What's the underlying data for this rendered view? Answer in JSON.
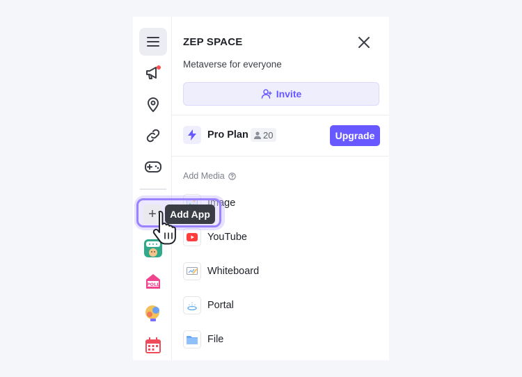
{
  "header": {
    "title": "ZEP SPACE",
    "subtitle": "Metaverse for everyone"
  },
  "invite": {
    "label": "Invite"
  },
  "plan": {
    "name": "Pro Plan",
    "member_count": "20",
    "upgrade_label": "Upgrade"
  },
  "media": {
    "section_label": "Add Media",
    "items": [
      {
        "label": "Image",
        "icon": "image-icon"
      },
      {
        "label": "YouTube",
        "icon": "youtube-icon"
      },
      {
        "label": "Whiteboard",
        "icon": "whiteboard-icon"
      },
      {
        "label": "Portal",
        "icon": "portal-icon"
      },
      {
        "label": "File",
        "icon": "folder-icon"
      }
    ]
  },
  "sidebar": {
    "items": [
      "menu-icon",
      "announcement-icon",
      "location-pin-icon",
      "link-icon",
      "gamepad-icon"
    ],
    "apps": [
      "chat-app-icon",
      "poll-app-icon",
      "quiz-app-icon",
      "calendar-app-icon"
    ]
  },
  "tooltip": {
    "label": "Add App",
    "button_glyph": "+"
  },
  "colors": {
    "accent": "#6758ff",
    "accent_light": "#efeefd",
    "notification": "#ff4d4d"
  }
}
